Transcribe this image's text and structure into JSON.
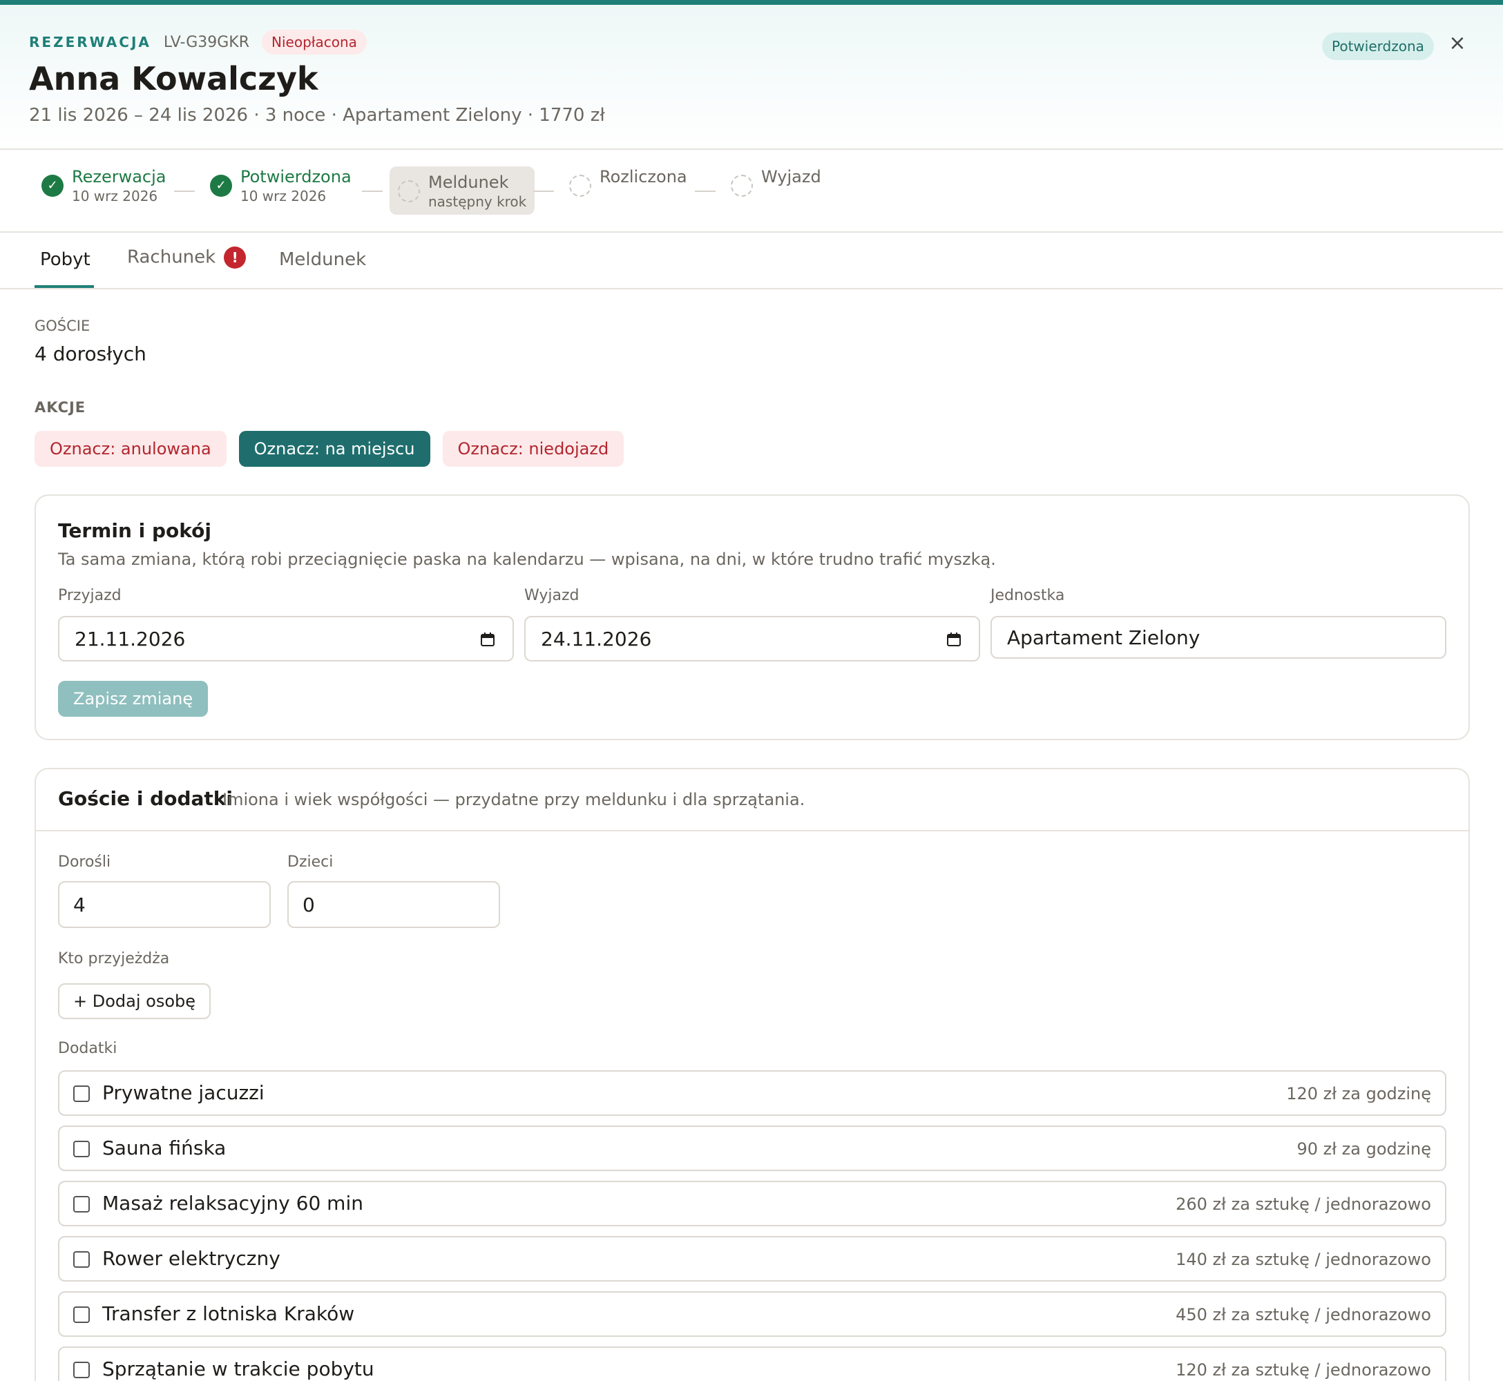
{
  "header": {
    "kicker": "REZERWACJA",
    "reference": "LV-G39GKR",
    "payment_badge": "Nieopłacona",
    "guest_name": "Anna Kowalczyk",
    "summary": "21 lis 2026 – 24 lis 2026 · 3 noce · Apartament Zielony · 1770 zł",
    "status": "Potwierdzona",
    "close_icon": "×"
  },
  "stepper": [
    {
      "label": "Rezerwacja",
      "sub": "10 wrz 2026",
      "state": "done"
    },
    {
      "label": "Potwierdzona",
      "sub": "10 wrz 2026",
      "state": "done"
    },
    {
      "label": "Meldunek",
      "sub": "następny krok",
      "state": "next"
    },
    {
      "label": "Rozliczona",
      "sub": "",
      "state": "todo"
    },
    {
      "label": "Wyjazd",
      "sub": "",
      "state": "todo"
    }
  ],
  "tabs": [
    {
      "label": "Pobyt",
      "active": true
    },
    {
      "label": "Rachunek",
      "alert": "!"
    },
    {
      "label": "Meldunek"
    }
  ],
  "guests": {
    "label": "GOŚCIE",
    "value": "4 dorosłych"
  },
  "actions": {
    "label": "AKCJE",
    "cancel": "Oznacz: anulowana",
    "onsite": "Oznacz: na miejscu",
    "noshow": "Oznacz: niedojazd"
  },
  "term_card": {
    "title": "Termin i pokój",
    "description": "Ta sama zmiana, którą robi przeciągnięcie paska na kalendarzu — wpisana, na dni, w które trudno trafić myszką.",
    "arrival_label": "Przyjazd",
    "arrival_value": "21.11.2026",
    "departure_label": "Wyjazd",
    "departure_value": "24.11.2026",
    "unit_label": "Jednostka",
    "unit_value": "Apartament Zielony",
    "save": "Zapisz zmianę"
  },
  "guests_card": {
    "title": "Goście i dodatki",
    "description": "Imiona i wiek współgości — przydatne przy meldunku i dla sprzątania.",
    "adults_label": "Dorośli",
    "adults_value": "4",
    "children_label": "Dzieci",
    "children_value": "0",
    "who_label": "Kto przyjeżdża",
    "add_person": "+ Dodaj osobę",
    "extras_label": "Dodatki",
    "extras": [
      {
        "name": "Prywatne jacuzzi",
        "price": "120 zł za godzinę"
      },
      {
        "name": "Sauna fińska",
        "price": "90 zł za godzinę"
      },
      {
        "name": "Masaż relaksacyjny 60 min",
        "price": "260 zł za sztukę / jednorazowo"
      },
      {
        "name": "Rower elektryczny",
        "price": "140 zł za sztukę / jednorazowo"
      },
      {
        "name": "Transfer z lotniska Kraków",
        "price": "450 zł za sztukę / jednorazowo"
      },
      {
        "name": "Sprzątanie w trakcie pobytu",
        "price": "120 zł za sztukę / jednorazowo"
      }
    ]
  }
}
